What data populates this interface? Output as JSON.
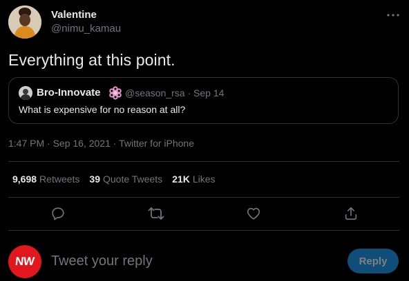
{
  "author": {
    "name": "Valentine",
    "handle": "@nimu_kamau"
  },
  "tweet": {
    "text": "Everything at this point."
  },
  "quoted_tweet": {
    "name": "Bro-Innovate",
    "meta": "@season_rsa · Sep 14",
    "text": "What is expensive for no reason at all?"
  },
  "timestamp": "1:47 PM · Sep 16, 2021 · Twitter for iPhone",
  "stats": {
    "retweets_count": "9,698",
    "retweets_label": "Retweets",
    "quotes_count": "39",
    "quotes_label": "Quote Tweets",
    "likes_count": "21K",
    "likes_label": "Likes"
  },
  "composer": {
    "avatar_text": "NW",
    "placeholder": "Tweet your reply",
    "reply_label": "Reply"
  },
  "icons": {
    "more": "more-icon",
    "reply": "reply-icon",
    "retweet": "retweet-icon",
    "like": "like-icon",
    "share": "share-icon"
  },
  "colors": {
    "background": "#000000",
    "text": "#e7e9ea",
    "muted": "#71767b",
    "border": "#2f3336",
    "accent": "#1d9bf0",
    "avatar_red": "#e0181e"
  }
}
